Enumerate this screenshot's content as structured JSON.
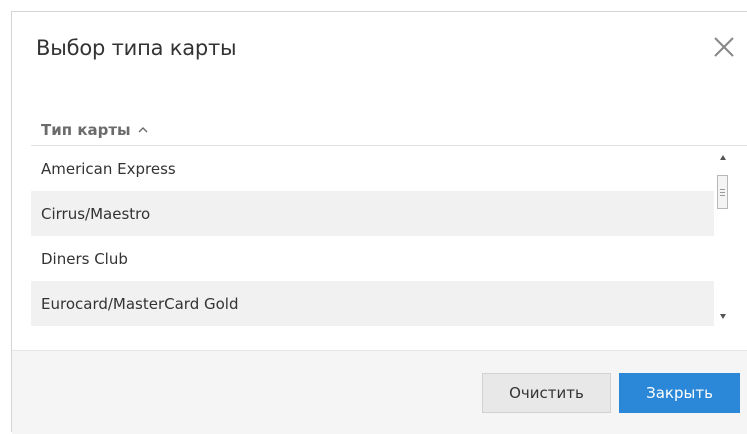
{
  "dialog": {
    "title": "Выбор типа карты",
    "close_icon": "close-icon"
  },
  "table": {
    "column_header": "Тип карты",
    "sort_icon": "chevron-up-icon",
    "rows": [
      "American Express",
      "Cirrus/Maestro",
      "Diners Club",
      "Eurocard/MasterCard Gold"
    ]
  },
  "footer": {
    "clear_label": "Очистить",
    "close_label": "Закрыть"
  },
  "colors": {
    "accent": "#2b88d8",
    "row_alt": "#f1f1f1",
    "footer_bg": "#f5f5f5"
  }
}
